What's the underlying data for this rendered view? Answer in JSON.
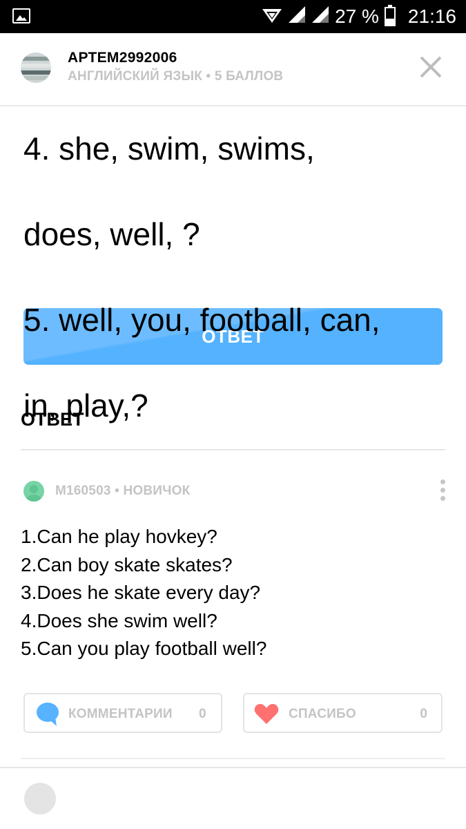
{
  "status_bar": {
    "battery_percent": "27 %",
    "time": "21:16",
    "icons": [
      "gallery-icon",
      "data-arrows-icon",
      "signal-icon",
      "signal-icon",
      "battery-icon"
    ]
  },
  "header": {
    "username": "АРТЕМ2992006",
    "subject_line": "АНГЛИЙСКИЙ ЯЗЫК • 5 БАЛЛОВ",
    "close_icon": "close-icon"
  },
  "question": {
    "lines": [
      "4. she, swim, swims,",
      "does, well, ?",
      "5. well, you, football, can,",
      "in, play,?"
    ]
  },
  "answer_button": {
    "label": "ОТВЕТ"
  },
  "answer_section": {
    "title": "ОТВЕТ",
    "author": "M160503 • НОВИЧОК",
    "lines": [
      "1.Can he play hovkey?",
      "2.Can boy skate skates?",
      "3.Does he skate every day?",
      "4.Does she swim well?",
      "5.Can you play football well?"
    ]
  },
  "actions": {
    "comments_label": "КОММЕНТАРИИ",
    "comments_count": "0",
    "thanks_label": "СПАСИБО",
    "thanks_count": "0"
  },
  "colors": {
    "accent_blue": "#57b2ff",
    "muted_text": "#c4c4c4",
    "heart_red": "#ff7070",
    "comment_blue": "#57b2ff"
  }
}
